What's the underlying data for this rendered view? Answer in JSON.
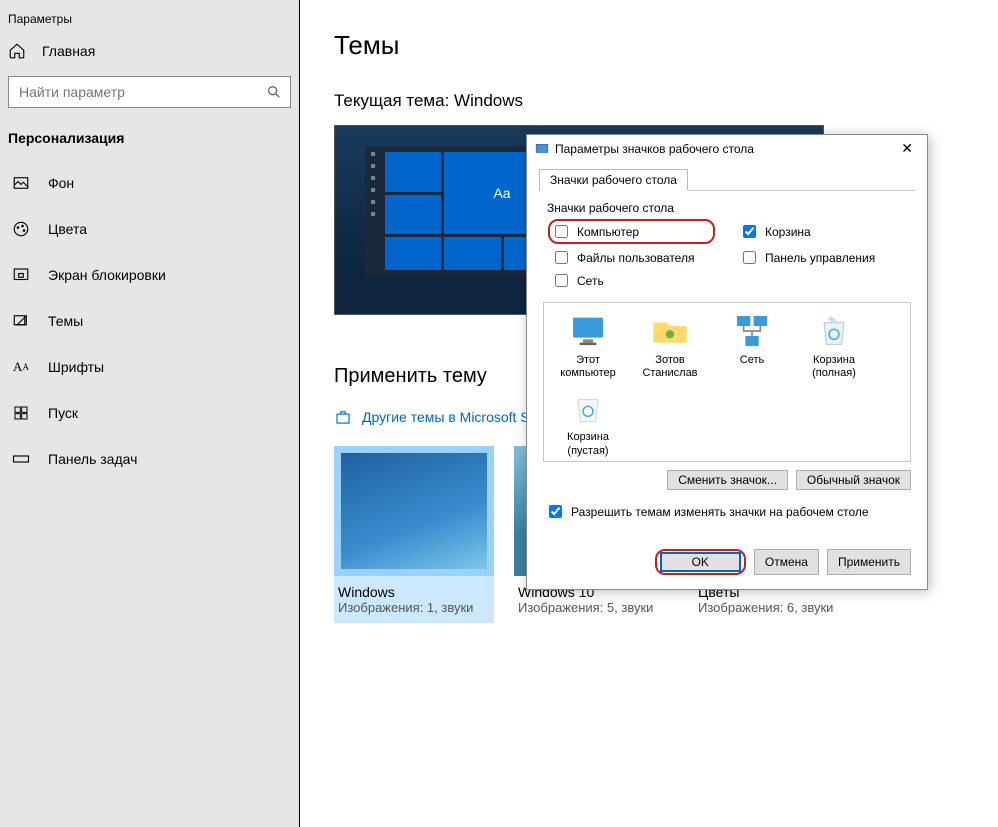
{
  "appTitle": "Параметры",
  "home": "Главная",
  "searchPlaceholder": "Найти параметр",
  "section": "Персонализация",
  "nav": [
    "Фон",
    "Цвета",
    "Экран блокировки",
    "Темы",
    "Шрифты",
    "Пуск",
    "Панель задач"
  ],
  "pageTitle": "Темы",
  "currentPrefix": "Текущая тема:",
  "currentTheme": "Windows",
  "applyHeader": "Применить тему",
  "storeLink": "Другие темы в Microsoft S",
  "themes": [
    {
      "name": "Windows",
      "desc": "Изображения: 1, звуки"
    },
    {
      "name": "Windows 10",
      "desc": "Изображения: 5, звуки"
    },
    {
      "name": "Цветы",
      "desc": "Изображения: 6, звуки"
    }
  ],
  "dialog": {
    "title": "Параметры значков рабочего стола",
    "tab": "Значки рабочего стола",
    "group": "Значки рабочего стола",
    "chk": {
      "computer": "Компьютер",
      "userfiles": "Файлы пользователя",
      "network": "Сеть",
      "recycle": "Корзина",
      "control": "Панель управления"
    },
    "icons": [
      "Этот компьютер",
      "Зотов Станислав",
      "Сеть",
      "Корзина (полная)",
      "Корзина (пустая)"
    ],
    "changeBtn": "Сменить значок...",
    "defaultBtn": "Обычный значок",
    "allow": "Разрешить темам изменять значки на рабочем столе",
    "ok": "OK",
    "cancel": "Отмена",
    "apply": "Применить"
  },
  "previewAa": "Aa"
}
